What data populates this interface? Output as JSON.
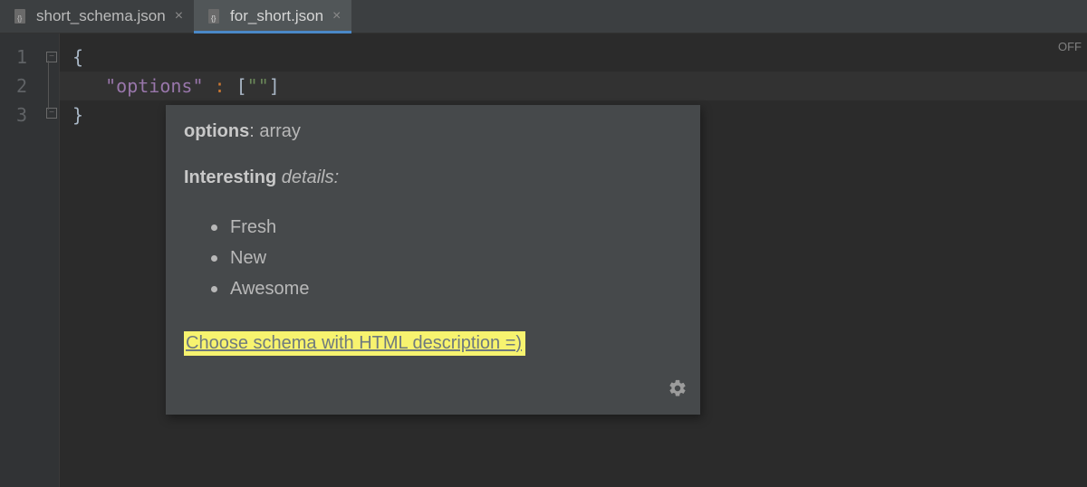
{
  "tabs": [
    {
      "label": "short_schema.json",
      "active": false
    },
    {
      "label": "for_short.json",
      "active": true
    }
  ],
  "gutter": [
    "1",
    "2",
    "3"
  ],
  "code": {
    "line1": "{",
    "line2_indent": "   ",
    "line2_key": "\"options\"",
    "line2_colon": " : ",
    "line2_open": "[",
    "line2_str": "\"\"",
    "line2_close": "]",
    "line3": "}"
  },
  "off_indicator": "OFF",
  "popup": {
    "title_key": "options",
    "title_type": ": array",
    "subtitle_bold": "Interesting",
    "subtitle_italic": " details:",
    "items": [
      "Fresh",
      "New",
      "Awesome"
    ],
    "note": "Choose schema with HTML description =)"
  }
}
